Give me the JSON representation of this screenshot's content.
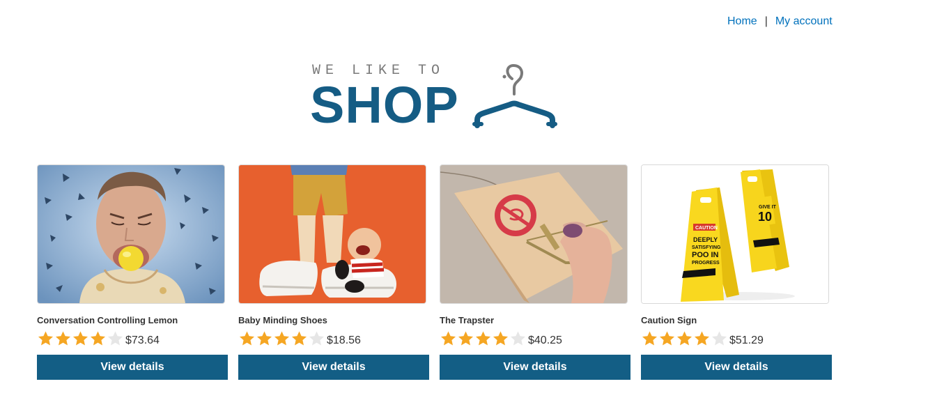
{
  "nav": {
    "home": "Home",
    "separator": "|",
    "account": "My account"
  },
  "logo": {
    "tagline": "WE LIKE TO",
    "word": "SHOP",
    "icon": "hanger-icon"
  },
  "colors": {
    "brand": "#155c84",
    "link": "#0071bc",
    "star_filled": "#f5a623",
    "star_empty": "#e6e6e6",
    "button": "#135e85"
  },
  "products": [
    {
      "name": "Conversation Controlling Lemon",
      "rating": 4,
      "max_rating": 5,
      "price": "$73.64",
      "button": "View details",
      "image": "man-with-lemon-in-mouth"
    },
    {
      "name": "Baby Minding Shoes",
      "rating": 4,
      "max_rating": 5,
      "price": "$18.56",
      "button": "View details",
      "image": "figurine-baby-on-shoes"
    },
    {
      "name": "The Trapster",
      "rating": 4,
      "max_rating": 5,
      "price": "$40.25",
      "button": "View details",
      "image": "mousetrap-on-thumb"
    },
    {
      "name": "Caution Sign",
      "rating": 4,
      "max_rating": 5,
      "price": "$51.29",
      "button": "View details",
      "image": "yellow-caution-signs"
    }
  ]
}
